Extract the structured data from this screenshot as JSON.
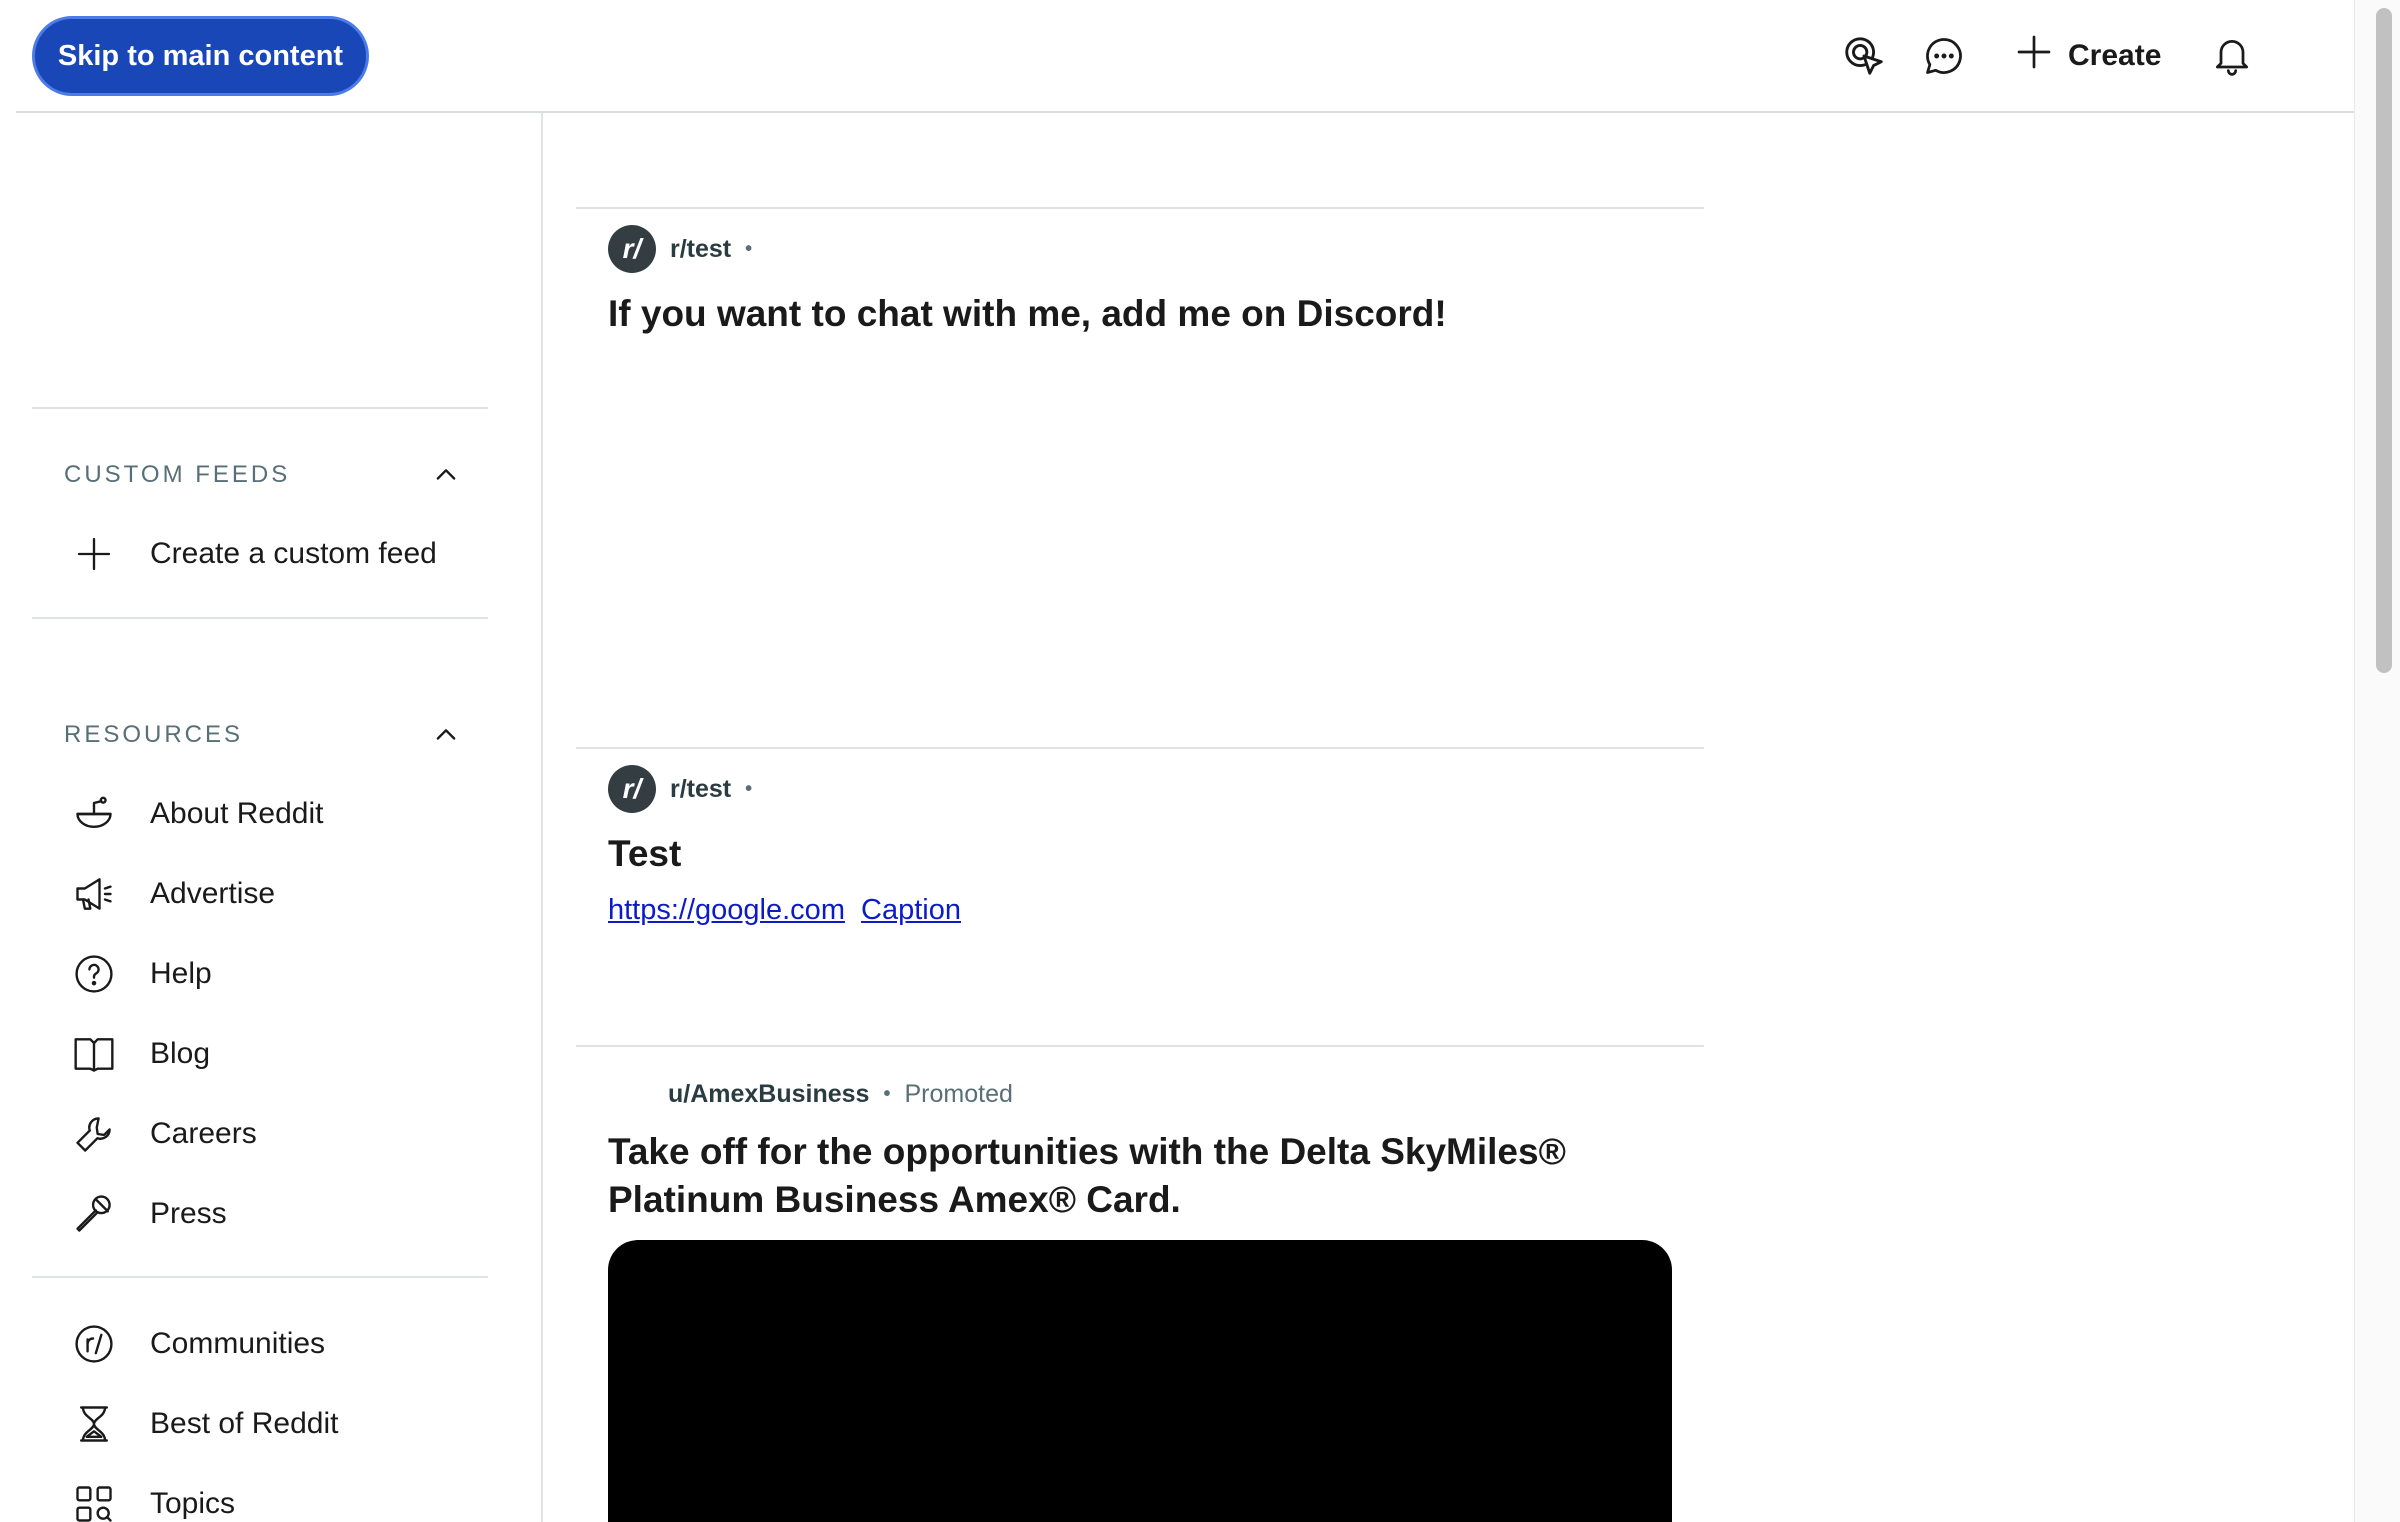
{
  "header": {
    "skip_label": "Skip to main content",
    "create_label": "Create"
  },
  "sidebar": {
    "custom_feeds": {
      "heading": "CUSTOM FEEDS",
      "create_label": "Create a custom feed"
    },
    "resources": {
      "heading": "RESOURCES",
      "items": [
        {
          "label": "About Reddit",
          "icon": "reddit-alien-icon"
        },
        {
          "label": "Advertise",
          "icon": "megaphone-icon"
        },
        {
          "label": "Help",
          "icon": "help-icon"
        },
        {
          "label": "Blog",
          "icon": "book-icon"
        },
        {
          "label": "Careers",
          "icon": "wrench-icon"
        },
        {
          "label": "Press",
          "icon": "microphone-icon"
        }
      ]
    },
    "more": [
      {
        "label": "Communities",
        "icon": "communities-icon"
      },
      {
        "label": "Best of Reddit",
        "icon": "hourglass-icon"
      },
      {
        "label": "Topics",
        "icon": "topics-icon"
      }
    ]
  },
  "feed": {
    "posts": [
      {
        "subreddit": "r/test",
        "title": "If you want to chat with me, add me on Discord!"
      },
      {
        "subreddit": "r/test",
        "title": "Test",
        "link_text": "https://google.com",
        "caption": "Caption"
      },
      {
        "author": "u/AmexBusiness",
        "badge": "Promoted",
        "title_line1": "Take off for the opportunities with the Delta SkyMiles®",
        "title_line2": "Platinum Business Amex® Card."
      }
    ],
    "separator": "•"
  }
}
